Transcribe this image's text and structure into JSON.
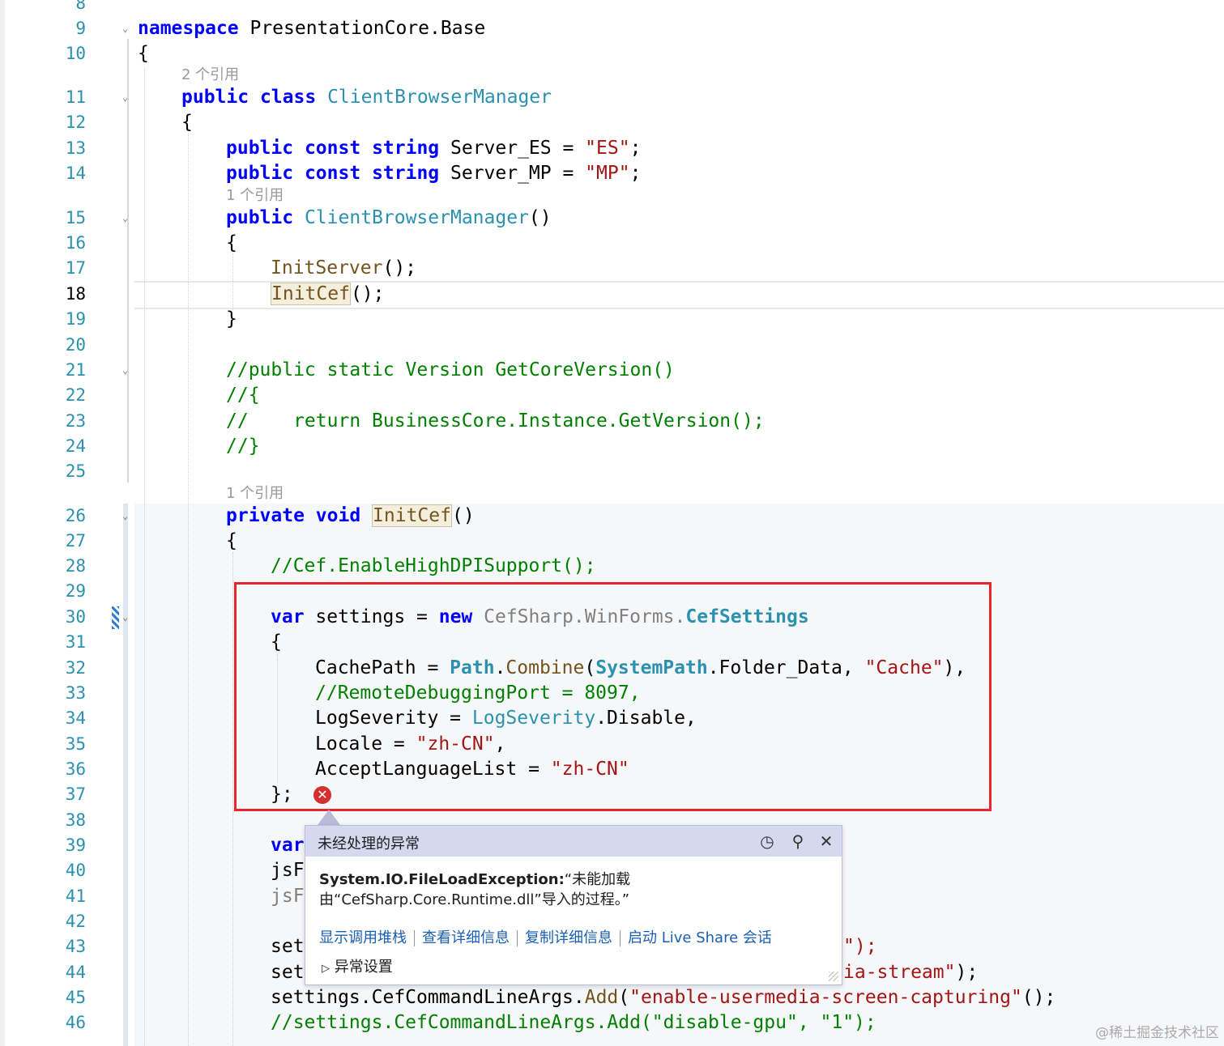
{
  "editor": {
    "line_numbers": [
      "8",
      "9",
      "10",
      "11",
      "12",
      "13",
      "14",
      "15",
      "16",
      "17",
      "18",
      "19",
      "20",
      "21",
      "22",
      "23",
      "24",
      "25",
      "26",
      "27",
      "28",
      "29",
      "30",
      "31",
      "32",
      "33",
      "34",
      "35",
      "36",
      "37",
      "38",
      "39",
      "40",
      "41",
      "42",
      "43",
      "44",
      "45",
      "46"
    ],
    "current_line": "18",
    "codelens": {
      "l11": "2 个引用",
      "l15": "1 个引用",
      "l26": "1 个引用"
    },
    "code": {
      "l9_kw": "namespace",
      "l9_name": " PresentationCore.Base",
      "brace_open": "{",
      "brace_close": "}",
      "parens": "()",
      "public": "public",
      "const": "const",
      "string": "string",
      "class": "class",
      "private": "private",
      "void": "void",
      "var": "var",
      "new": "new",
      "class_name": "ClientBrowserManager",
      "server_es": " Server_ES = ",
      "es_str": "\"ES\"",
      "server_mp": " Server_MP = ",
      "mp_str": "\"MP\"",
      "semicolon": ";",
      "init_server": "InitServer",
      "call_end": "();",
      "init_cef": "InitCef",
      "c21": "//public static Version GetCoreVersion()",
      "c22": "//{",
      "c23": "//    return BusinessCore.Instance.GetVersion();",
      "c24": "//}",
      "c28": "//Cef.EnableHighDPISupport();",
      "settings_eq": " settings = ",
      "cefsharp_ns": "CefSharp.WinForms.",
      "cef_settings": "CefSettings",
      "cache_path": "CachePath = ",
      "path": "Path",
      "dot": ".",
      "combine": "Combine",
      "lparen": "(",
      "system_path": "SystemPath",
      "folder_data": ".Folder_Data, ",
      "cache_str": "\"Cache\"",
      "paren_comma": "),",
      "c33": "//RemoteDebuggingPort = 8097,",
      "log_severity_eq": "LogSeverity = ",
      "log_severity": "LogSeverity",
      "disable": ".Disable,",
      "locale_eq": "Locale = ",
      "zh_cn": "\"zh-CN\"",
      "comma": ",",
      "accept_lang": "AcceptLanguageList = ",
      "close_semi": "};",
      "l40": "jsF",
      "l41": "jsF",
      "l43": "set",
      "l44": "set",
      "l43_tail": "\");",
      "l44_str": "ia-stream\"",
      "l44_tail": ");",
      "l45_a": "settings.CefCommandLineArgs.",
      "add": "Add",
      "l45_str": "\"enable-usermedia-screen-capturing\"",
      "l46": "//settings.CefCommandLineArgs.Add(\"disable-gpu\", \"1\");"
    }
  },
  "exception_popup": {
    "title": "未经处理的异常",
    "exception_type": "System.IO.FileLoadException:",
    "message_1": "“未能加载",
    "message_2": "由“CefSharp.Core.Runtime.dll”导入的过程。”",
    "links": [
      "显示调用堆栈",
      "查看详细信息",
      "复制详细信息",
      "启动 Live Share 会话"
    ],
    "exception_settings": "异常设置",
    "icons": [
      "history-icon",
      "pin-icon",
      "close-icon"
    ]
  },
  "watermark": "@稀土掘金技术社区",
  "colors": {
    "keyword": "#0000ff",
    "type": "#2b91af",
    "method": "#74531f",
    "string": "#a31515",
    "comment": "#008000",
    "error_box": "#e8262c",
    "popup_header": "#d4d9ef"
  }
}
